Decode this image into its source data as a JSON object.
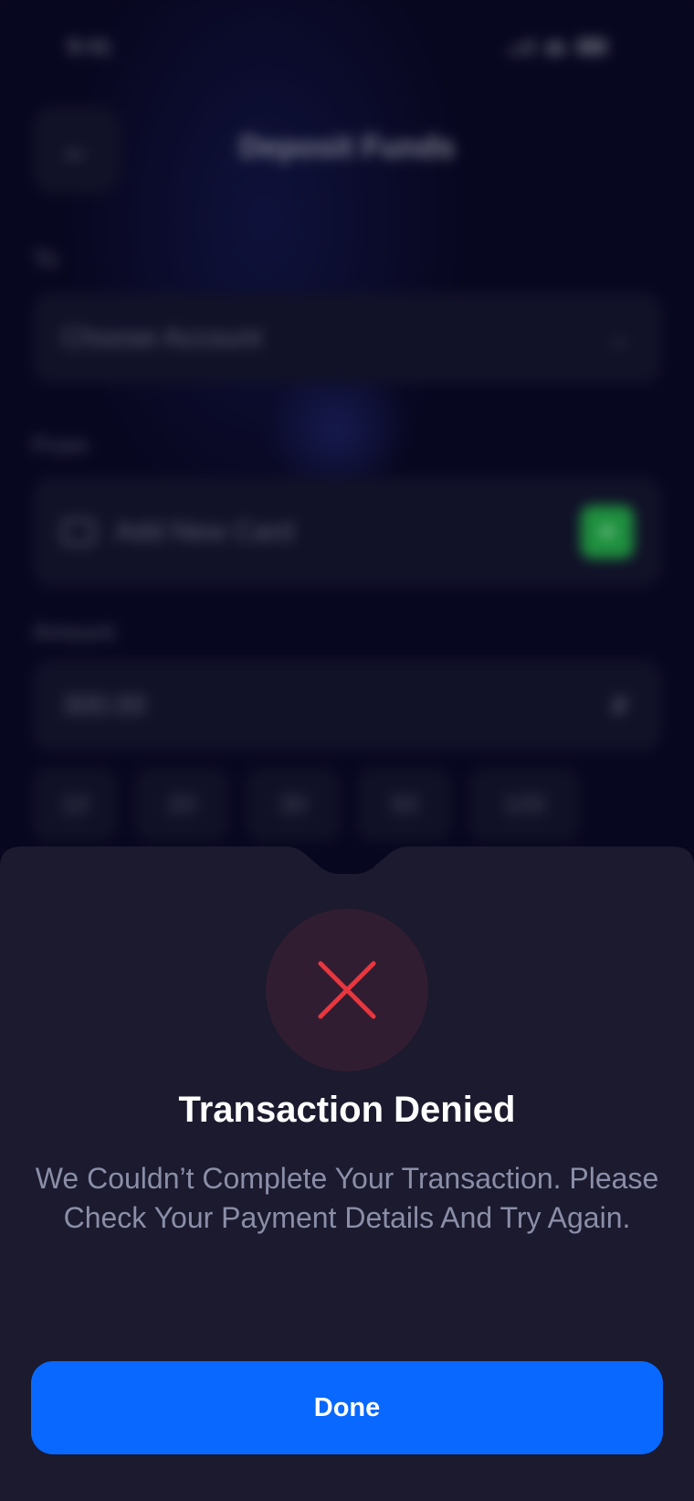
{
  "status_bar": {
    "time": "9:41"
  },
  "header": {
    "title": "Deposit Funds",
    "back_icon": "arrow-left-icon"
  },
  "form": {
    "to_label": "To",
    "to_value": "Choose Account",
    "from_label": "From",
    "from_value": "Add New Card",
    "amount_label": "Amount",
    "amount_value": "300.00",
    "currency_symbol": "₽",
    "quick_amounts": [
      "10",
      "20",
      "30",
      "50",
      "100"
    ]
  },
  "dialog": {
    "icon": "close-icon",
    "title": "Transaction Denied",
    "message": "We Couldn’t Complete Your Transaction. Please Check Your Payment Details And Try Again.",
    "done_label": "Done"
  },
  "colors": {
    "accent": "#0868ff",
    "error": "#e8363f",
    "sheet_background": "#1b1a2e",
    "add_card_button": "#1e8f3e"
  }
}
